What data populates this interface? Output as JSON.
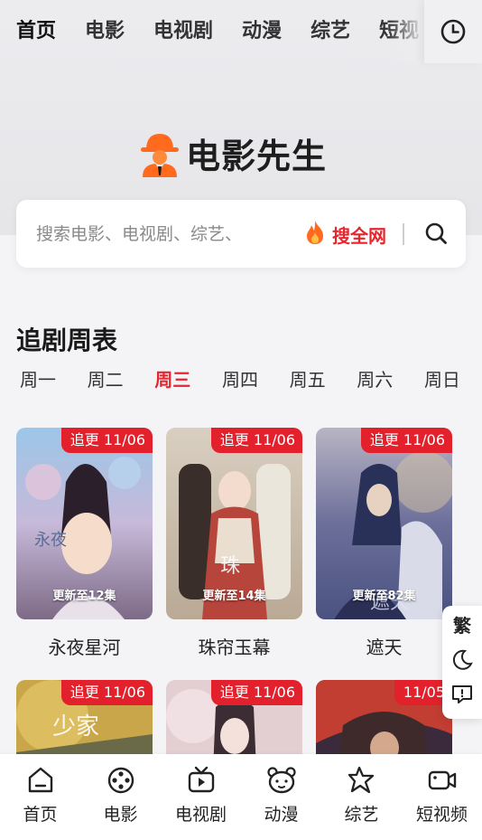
{
  "colors": {
    "accent": "#e6262f",
    "tab_underline": "#ff5a2f",
    "badge": "#e3212d"
  },
  "top_nav": {
    "tabs": [
      {
        "label": "首页",
        "active": true
      },
      {
        "label": "电影",
        "active": false
      },
      {
        "label": "电视剧",
        "active": false
      },
      {
        "label": "动漫",
        "active": false
      },
      {
        "label": "综艺",
        "active": false
      },
      {
        "label": "短视",
        "active": false
      }
    ],
    "history_icon": "clock-icon"
  },
  "logo": {
    "text": "电影先生",
    "icon": "detective-avatar-icon"
  },
  "search": {
    "placeholder": "搜索电影、电视剧、综艺、",
    "search_all_label": "搜全网",
    "fire_icon": "fire-icon",
    "search_icon": "search-icon"
  },
  "schedule": {
    "title": "追剧周表",
    "days": [
      {
        "label": "周一",
        "active": false
      },
      {
        "label": "周二",
        "active": false
      },
      {
        "label": "周三",
        "active": true
      },
      {
        "label": "周四",
        "active": false
      },
      {
        "label": "周五",
        "active": false
      },
      {
        "label": "周六",
        "active": false
      },
      {
        "label": "周日",
        "active": false
      }
    ],
    "cards": [
      {
        "badge": "追更 11/06",
        "episodes": "更新至12集",
        "title": "永夜星河"
      },
      {
        "badge": "追更 11/06",
        "episodes": "更新至14集",
        "title": "珠帘玉幕"
      },
      {
        "badge": "追更 11/06",
        "episodes": "更新至82集",
        "title": "遮天"
      },
      {
        "badge": "追更 11/06",
        "episodes": "",
        "title": ""
      },
      {
        "badge": "追更 11/06",
        "episodes": "",
        "title": ""
      },
      {
        "badge": "11/05",
        "episodes": "",
        "title": ""
      }
    ]
  },
  "side_float": {
    "traditional_label": "繁",
    "dark_mode_icon": "moon-icon",
    "feedback_icon": "feedback-icon"
  },
  "bottom_nav": {
    "items": [
      {
        "label": "首页",
        "icon": "home-icon"
      },
      {
        "label": "电影",
        "icon": "film-reel-icon"
      },
      {
        "label": "电视剧",
        "icon": "tv-icon"
      },
      {
        "label": "动漫",
        "icon": "bear-face-icon"
      },
      {
        "label": "综艺",
        "icon": "star-icon"
      },
      {
        "label": "短视频",
        "icon": "video-camera-icon"
      }
    ]
  }
}
